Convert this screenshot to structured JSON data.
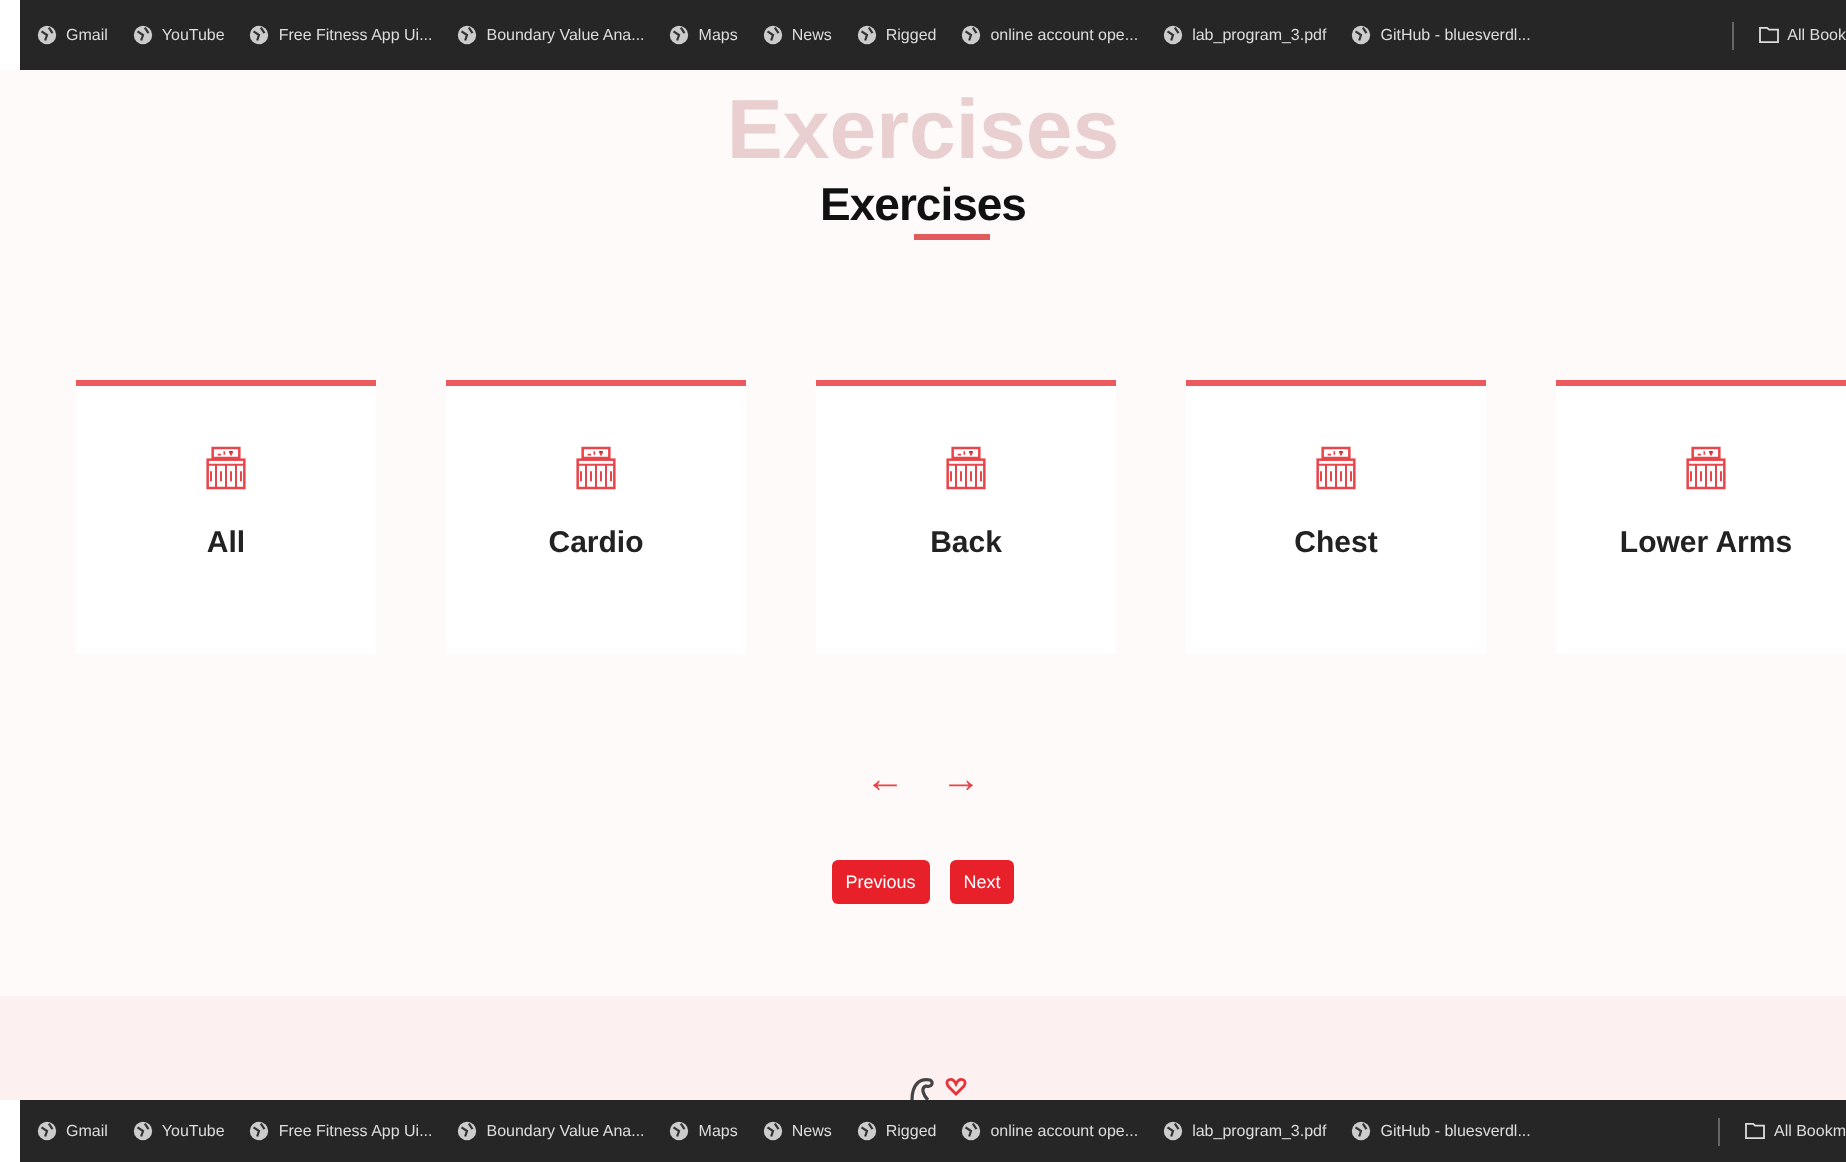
{
  "bookmarks_top": [
    {
      "label": "Gmail"
    },
    {
      "label": "YouTube"
    },
    {
      "label": "Free Fitness App Ui..."
    },
    {
      "label": "Boundary Value Ana..."
    },
    {
      "label": "Maps"
    },
    {
      "label": "News"
    },
    {
      "label": "Rigged"
    },
    {
      "label": "online account ope..."
    },
    {
      "label": "lab_program_3.pdf"
    },
    {
      "label": "GitHub - bluesverdl..."
    }
  ],
  "all_bookmarks_top": "All Book",
  "section": {
    "background_title": "Exercises",
    "title": "Exercises"
  },
  "categories": [
    {
      "name": "All"
    },
    {
      "name": "Cardio"
    },
    {
      "name": "Back"
    },
    {
      "name": "Chest"
    },
    {
      "name": "Lower Arms"
    }
  ],
  "arrows": {
    "left": "←",
    "right": "→"
  },
  "buttons": [
    {
      "label": "Previous"
    },
    {
      "label": "Next"
    }
  ],
  "bookmarks_bottom": [
    {
      "label": "Gmail"
    },
    {
      "label": "YouTube"
    },
    {
      "label": "Free Fitness App Ui..."
    },
    {
      "label": "Boundary Value Ana..."
    },
    {
      "label": "Maps"
    },
    {
      "label": "News"
    },
    {
      "label": "Rigged"
    },
    {
      "label": "online account ope..."
    },
    {
      "label": "lab_program_3.pdf"
    },
    {
      "label": "GitHub - bluesverdl..."
    }
  ],
  "all_bookmarks_bottom": "All Bookm"
}
